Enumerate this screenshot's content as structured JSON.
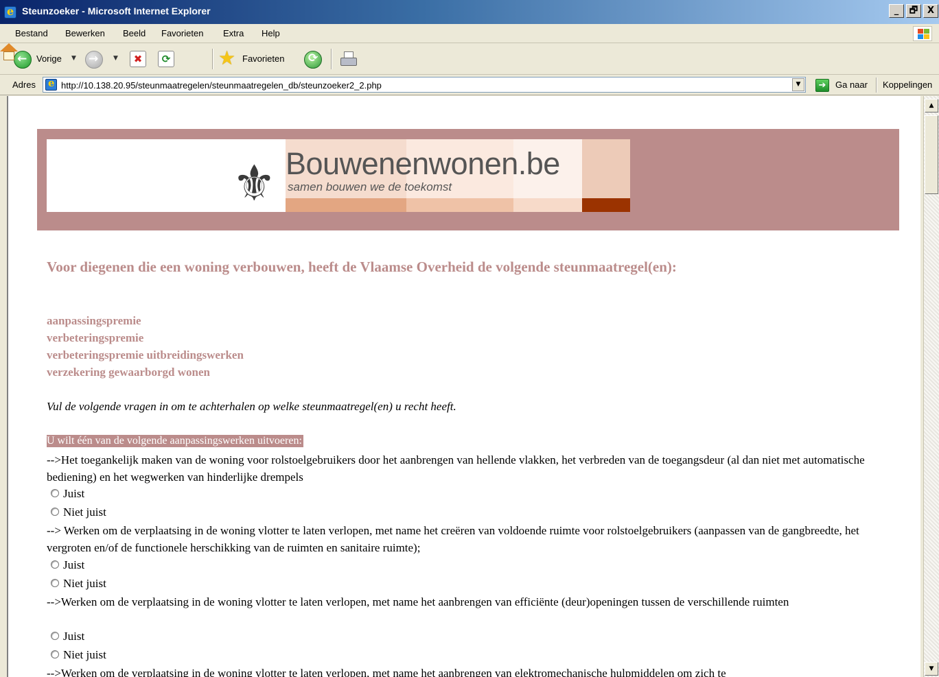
{
  "window": {
    "title": "Steunzoeker - Microsoft Internet Explorer",
    "controls": [
      "_",
      "🗗",
      "X"
    ]
  },
  "menu": [
    "Bestand",
    "Bewerken",
    "Beeld",
    "Favorieten",
    "Extra",
    "Help"
  ],
  "toolbar": {
    "back_label": "Vorige",
    "favorites_label": "Favorieten",
    "icons": [
      "back-icon",
      "forward-icon",
      "stop-icon",
      "refresh-icon",
      "home-icon",
      "favorites-icon",
      "history-icon",
      "print-icon"
    ]
  },
  "address": {
    "label": "Adres",
    "url": "http://10.138.20.95/steunmaatregelen/steunmaatregelen_db/steunzoeker2_2.php",
    "go_label": "Ga naar",
    "links_label": "Koppelingen"
  },
  "banner": {
    "brand": "Bouwenenwonen.be",
    "tagline": "samen bouwen we de toekomst",
    "colors": {
      "frame": "#bb8c8b",
      "dark_strip": "#9b3300"
    }
  },
  "page": {
    "heading": "Voor diegenen die een woning verbouwen, heeft de Vlaamse Overheid de volgende steunmaatregel(en):",
    "measures": [
      "aanpassingspremie",
      "verbeteringspremie",
      "verbeteringspremie uitbreidingswerken",
      "verzekering gewaarborgd wonen"
    ],
    "intro": "Vul de volgende vragen in om te achterhalen op welke steunmaatregel(en) u recht heeft.",
    "section_heading": "U wilt één van de volgende aanpassingswerken uitvoeren:",
    "questions": [
      {
        "text": "-->Het toegankelijk maken van de woning voor rolstoelgebruikers door het aanbrengen van hellende vlakken, het verbreden van de toegangsdeur (al dan niet met automatische bediening) en het wegwerken van hinderlijke drempels",
        "options": [
          "Juist",
          "Niet juist"
        ]
      },
      {
        "text": "--> Werken om de verplaatsing in de woning vlotter te laten verlopen, met name het creëren van voldoende ruimte voor rolstoelgebruikers (aanpassen van de gangbreedte, het vergroten en/of de functionele herschikking van de ruimten en sanitaire ruimte);",
        "options": [
          "Juist",
          "Niet juist"
        ]
      },
      {
        "text": "-->Werken om de verplaatsing in de woning vlotter te laten verlopen, met name het aanbrengen van efficiënte (deur)openingen tussen de verschillende ruimten",
        "options": [
          "Juist",
          "Niet juist"
        ]
      },
      {
        "text": "-->Werken om de verplaatsing in de woning vlotter te laten verlopen, met name het aanbrengen van elektromechanische hulpmiddelen om zich te",
        "options": []
      }
    ]
  }
}
